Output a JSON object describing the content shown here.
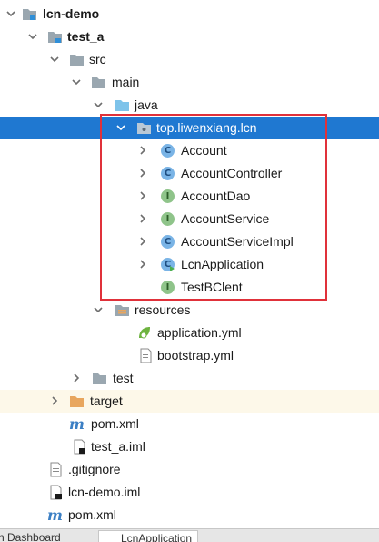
{
  "tree": {
    "root": "lcn-demo",
    "module": "test_a",
    "src": "src",
    "main": "main",
    "java": "java",
    "package": "top.liwenxiang.lcn",
    "classes": [
      {
        "name": "Account",
        "kind": "class"
      },
      {
        "name": "AccountController",
        "kind": "class"
      },
      {
        "name": "AccountDao",
        "kind": "interface"
      },
      {
        "name": "AccountService",
        "kind": "interface"
      },
      {
        "name": "AccountServiceImpl",
        "kind": "class"
      },
      {
        "name": "LcnApplication",
        "kind": "spring-boot-class"
      },
      {
        "name": "TestBClent",
        "kind": "interface"
      }
    ],
    "resources": "resources",
    "resource_files": [
      "application.yml",
      "bootstrap.yml"
    ],
    "test": "test",
    "target": "target",
    "module_files": [
      "pom.xml",
      "test_a.iml"
    ],
    "root_files": [
      ".gitignore",
      "lcn-demo.iml",
      "pom.xml"
    ]
  },
  "badges": {
    "class": "C",
    "interface": "I"
  },
  "bottom_tabs": [
    "n Dashboard",
    "LcnApplication"
  ],
  "colors": {
    "selection": "#1f78d1",
    "highlight_box": "#e0313a",
    "folder": "#9aa7b0",
    "source_folder": "#7ec3ea",
    "excluded_folder": "#e8a65e",
    "excluded_row": "#fdf8e9"
  }
}
